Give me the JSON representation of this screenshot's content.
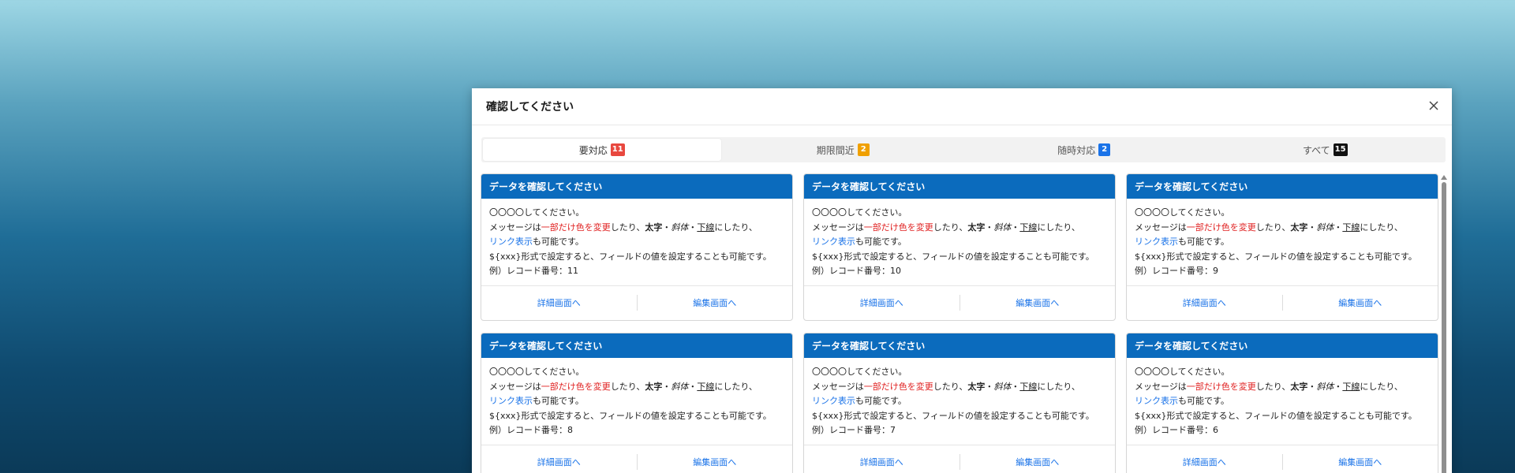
{
  "modal": {
    "title": "確認してください",
    "close_icon": "close-icon"
  },
  "tabs": [
    {
      "label": "要対応",
      "count": "11",
      "badge_color": "#e8483f",
      "active": true
    },
    {
      "label": "期限間近",
      "count": "2",
      "badge_color": "#f0a000",
      "active": false
    },
    {
      "label": "随時対応",
      "count": "2",
      "badge_color": "#1a73e8",
      "active": false
    },
    {
      "label": "すべて",
      "count": "15",
      "badge_color": "#111111",
      "active": false
    }
  ],
  "card_text": {
    "title": "データを確認してください",
    "line1": "〇〇〇〇してください。",
    "line2_prefix": "メッセージは",
    "line2_red": "一部だけ色を変更",
    "line2_mid": "したり、",
    "line2_bold": "太字",
    "line2_sep1": "・",
    "line2_italic": "斜体",
    "line2_sep2": "・",
    "line2_underline": "下線",
    "line2_suffix": "にしたり、",
    "line3_link": "リンク表示",
    "line3_suffix": "も可能です。",
    "line4": "${xxx}形式で設定すると、フィールドの値を設定することも可能です。",
    "record_prefix": "例）レコード番号：",
    "detail_label": "詳細画面へ",
    "edit_label": "編集画面へ"
  },
  "cards": [
    {
      "record": "11"
    },
    {
      "record": "10"
    },
    {
      "record": "9"
    },
    {
      "record": "8"
    },
    {
      "record": "7"
    },
    {
      "record": "6"
    }
  ],
  "colors": {
    "card_header": "#0b6bbd",
    "link": "#1a73e8",
    "red_text": "#e02020"
  }
}
